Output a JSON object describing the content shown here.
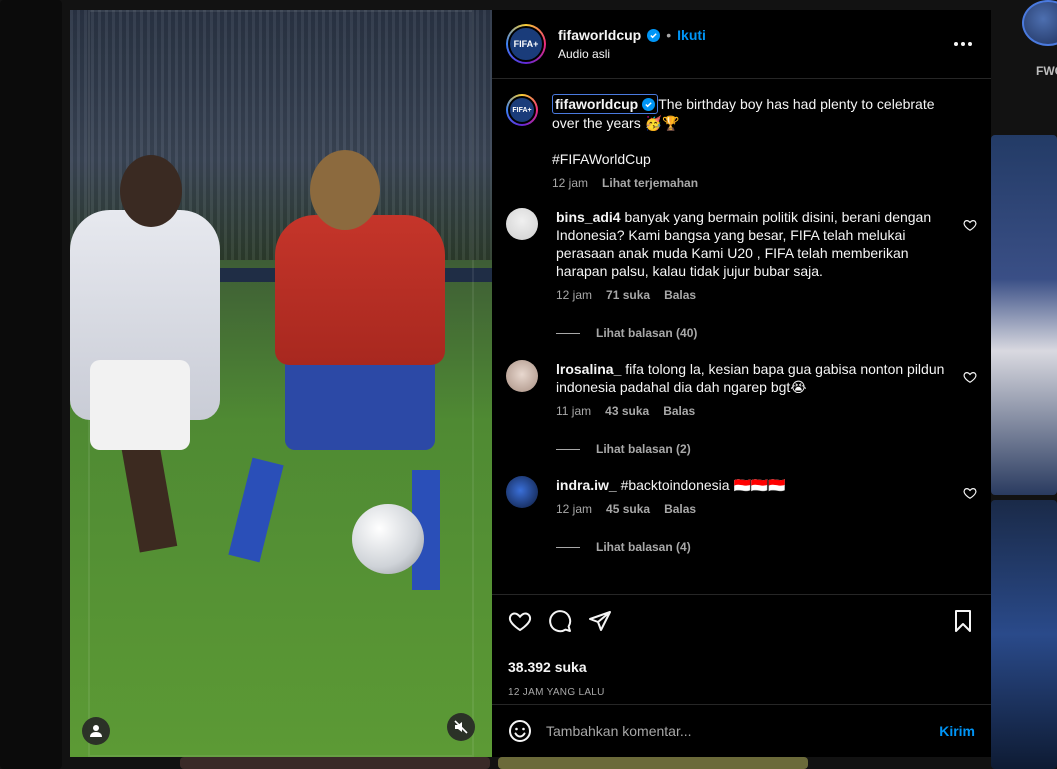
{
  "post": {
    "username": "fifaworldcup",
    "follow_label": "Ikuti",
    "subtitle": "Audio asli",
    "avatar_text": "FIFA+",
    "caption": "The birthday boy has had plenty to celebrate over the years 🥳🏆",
    "hashtag": "#FIFAWorldCup",
    "caption_time": "12 jam",
    "translate_label": "Lihat terjemahan",
    "likes": "38.392 suka",
    "timestamp": "12 JAM YANG LALU"
  },
  "comments": [
    {
      "username": "bins_adi4",
      "text": "banyak yang bermain politik disini, berani dengan Indonesia? Kami bangsa yang besar, FIFA telah melukai perasaan anak muda Kami U20 , FIFA telah memberikan harapan palsu, kalau tidak jujur bubar saja.",
      "time": "12 jam",
      "likes": "71 suka",
      "reply": "Balas",
      "view_replies": "Lihat balasan (40)"
    },
    {
      "username": "lrosalina_",
      "text": "fifa tolong la, kesian bapa gua gabisa nonton pildun indonesia padahal dia dah ngarep bgt😭",
      "time": "11 jam",
      "likes": "43 suka",
      "reply": "Balas",
      "view_replies": "Lihat balasan (2)"
    },
    {
      "username": "indra.iw_",
      "text": "#backtoindonesia 🇮🇩🇮🇩🇮🇩",
      "time": "12 jam",
      "likes": "45 suka",
      "reply": "Balas",
      "view_replies": "Lihat balasan (4)"
    }
  ],
  "composer": {
    "placeholder": "Tambahkan komentar...",
    "send_label": "Kirim"
  },
  "background": {
    "side_label": "FWC"
  },
  "colors": {
    "accent": "#0095f6",
    "panel_bg": "#000000",
    "muted_text": "#a8a8a8"
  }
}
